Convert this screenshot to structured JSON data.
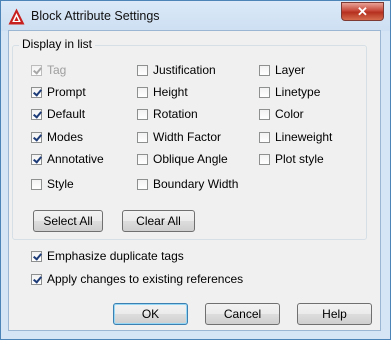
{
  "window": {
    "title": "Block Attribute Settings",
    "close_glyph": "✕"
  },
  "display_group": {
    "label": "Display in list"
  },
  "columns": [
    [
      {
        "label": "Tag",
        "checked": true,
        "disabled": true
      },
      {
        "label": "Prompt",
        "checked": true,
        "disabled": false
      },
      {
        "label": "Default",
        "checked": true,
        "disabled": false
      },
      {
        "label": "Modes",
        "checked": true,
        "disabled": false
      },
      {
        "label": "Annotative",
        "checked": true,
        "disabled": false
      },
      {
        "label": "Style",
        "checked": false,
        "disabled": false
      }
    ],
    [
      {
        "label": "Justification",
        "checked": false,
        "disabled": false
      },
      {
        "label": "Height",
        "checked": false,
        "disabled": false
      },
      {
        "label": "Rotation",
        "checked": false,
        "disabled": false
      },
      {
        "label": "Width Factor",
        "checked": false,
        "disabled": false
      },
      {
        "label": "Oblique Angle",
        "checked": false,
        "disabled": false
      },
      {
        "label": "Boundary Width",
        "checked": false,
        "disabled": false
      }
    ],
    [
      {
        "label": "Layer",
        "checked": false,
        "disabled": false
      },
      {
        "label": "Linetype",
        "checked": false,
        "disabled": false
      },
      {
        "label": "Color",
        "checked": false,
        "disabled": false
      },
      {
        "label": "Lineweight",
        "checked": false,
        "disabled": false
      },
      {
        "label": "Plot style",
        "checked": false,
        "disabled": false
      }
    ]
  ],
  "select_all_label": "Select All",
  "clear_all_label": "Clear All",
  "options": [
    {
      "label": "Emphasize duplicate tags",
      "checked": true
    },
    {
      "label": "Apply changes to existing references",
      "checked": true
    }
  ],
  "buttons": {
    "ok": "OK",
    "cancel": "Cancel",
    "help": "Help"
  },
  "colors": {
    "title_bar": "#d6e5f5",
    "client_bg": "#f0f0f0",
    "app_icon_red": "#c8201e",
    "close_red": "#c7483a"
  },
  "icons": {
    "app": "autocad-icon",
    "close": "close-icon"
  }
}
